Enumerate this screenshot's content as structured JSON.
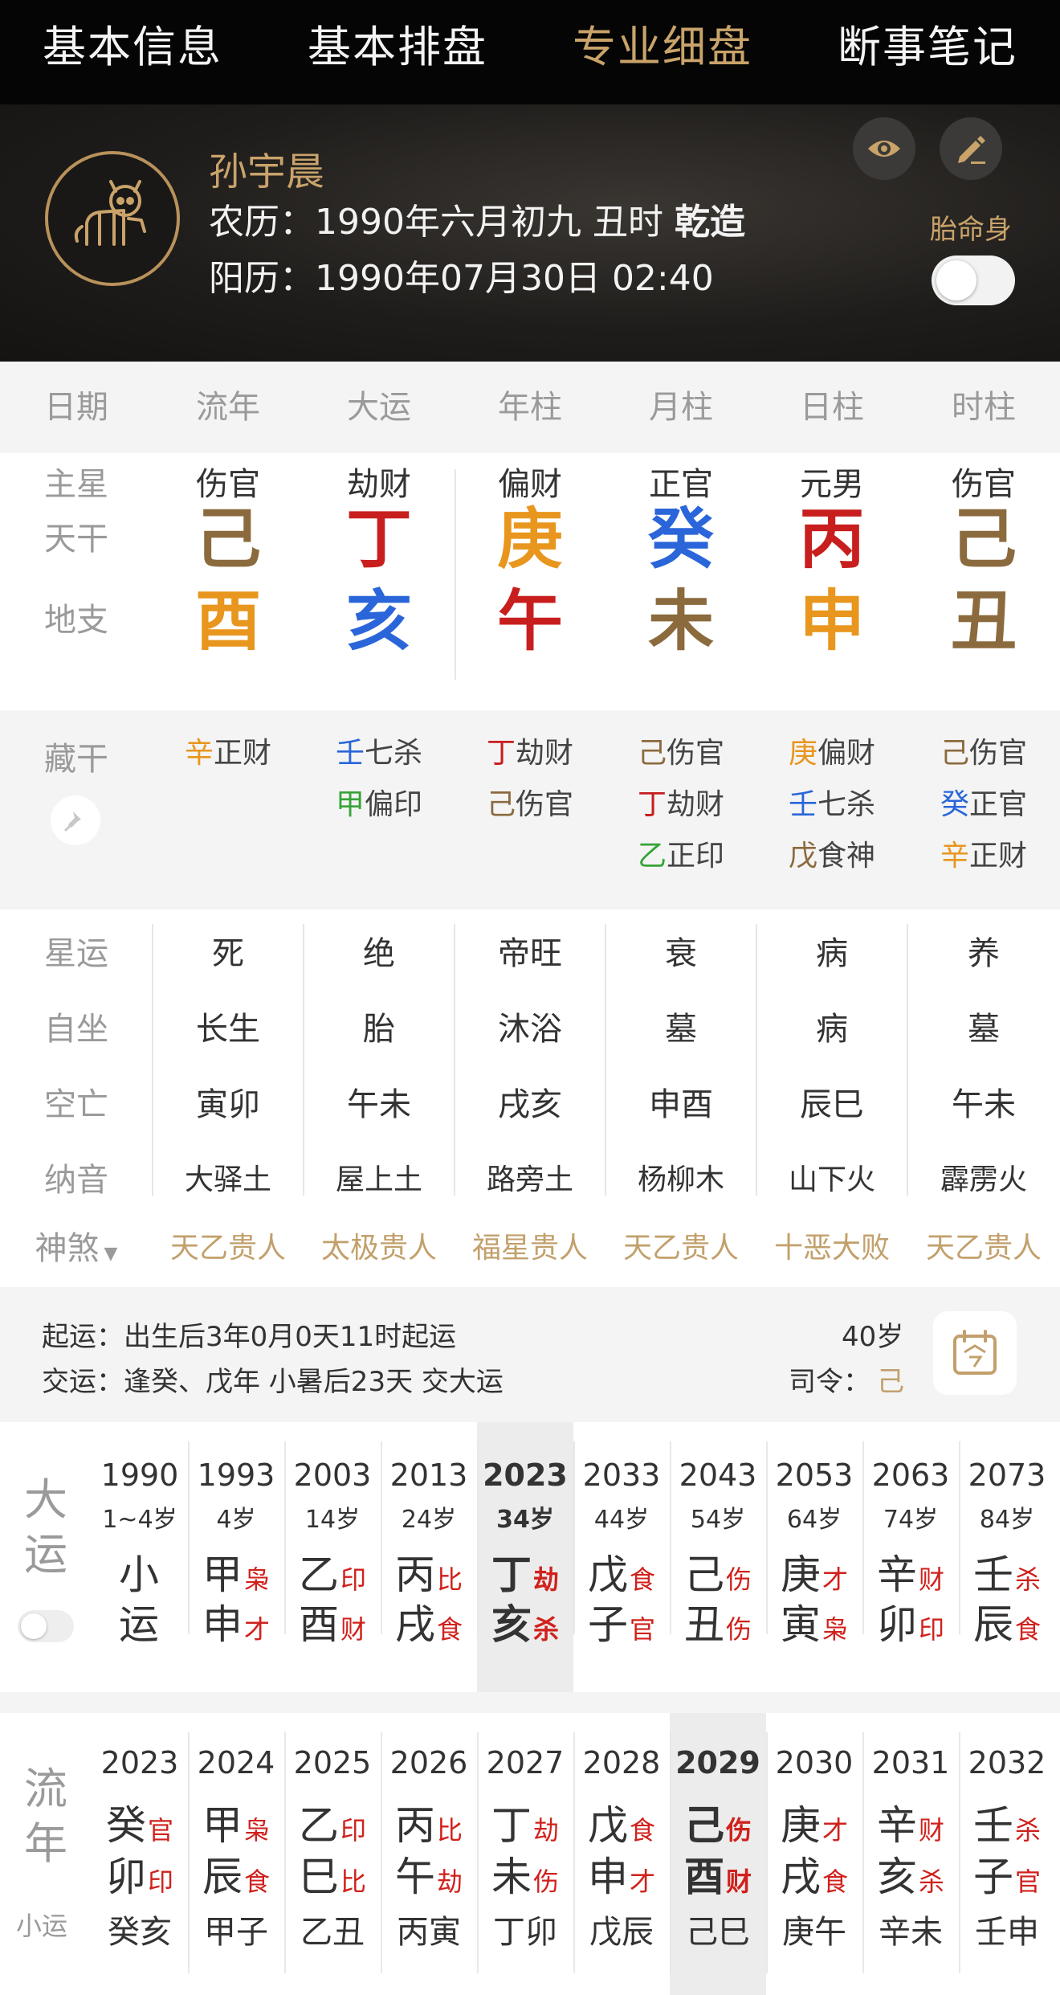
{
  "nav": [
    "基本信息",
    "基本排盘",
    "专业细盘",
    "断事笔记"
  ],
  "nav_active_index": 2,
  "colors": {
    "wood": "#36a336",
    "fire": "#c81e1e",
    "earth": "#8b6a3e",
    "metal": "#e8961e",
    "water": "#2a66d9",
    "accent": "#c9a36a",
    "ganzhi_red": "#d0211c"
  },
  "profile": {
    "name": "孙宇晨",
    "lunar_label": "农历：",
    "lunar": "1990年六月初九 丑时",
    "gender_tag": "乾造",
    "solar_label": "阳历：",
    "solar": "1990年07月30日 02:40",
    "taiming_label": "胎命身",
    "taiming_on": false,
    "avatar_icon": "horse-zodiac-icon"
  },
  "columns": [
    "日期",
    "流年",
    "大运",
    "年柱",
    "月柱",
    "日柱",
    "时柱"
  ],
  "row_labels": {
    "zhuxing": "主星",
    "tiangan": "天干",
    "dizhi": "地支",
    "canggan": "藏干",
    "xingyun": "星运",
    "zizuo": "自坐",
    "kongwang": "空亡",
    "nayin": "纳音",
    "shensha": "神煞"
  },
  "zhuxing": [
    "伤官",
    "劫财",
    "偏财",
    "正官",
    "元男",
    "伤官"
  ],
  "tiangan": [
    {
      "c": "己",
      "color": "#8b6a3e"
    },
    {
      "c": "丁",
      "color": "#c81e1e"
    },
    {
      "c": "庚",
      "color": "#e8961e"
    },
    {
      "c": "癸",
      "color": "#2a66d9"
    },
    {
      "c": "丙",
      "color": "#c81e1e"
    },
    {
      "c": "己",
      "color": "#8b6a3e"
    }
  ],
  "dizhi": [
    {
      "c": "酉",
      "color": "#e8961e"
    },
    {
      "c": "亥",
      "color": "#2a66d9"
    },
    {
      "c": "午",
      "color": "#c81e1e"
    },
    {
      "c": "未",
      "color": "#8b6a3e"
    },
    {
      "c": "申",
      "color": "#e8961e"
    },
    {
      "c": "丑",
      "color": "#8b6a3e"
    }
  ],
  "canggan": [
    [
      {
        "g": "辛",
        "color": "#e8961e",
        "s": "正财"
      }
    ],
    [
      {
        "g": "壬",
        "color": "#2a66d9",
        "s": "七杀"
      },
      {
        "g": "甲",
        "color": "#36a336",
        "s": "偏印"
      }
    ],
    [
      {
        "g": "丁",
        "color": "#c81e1e",
        "s": "劫财"
      },
      {
        "g": "己",
        "color": "#8b6a3e",
        "s": "伤官"
      }
    ],
    [
      {
        "g": "己",
        "color": "#8b6a3e",
        "s": "伤官"
      },
      {
        "g": "丁",
        "color": "#c81e1e",
        "s": "劫财"
      },
      {
        "g": "乙",
        "color": "#36a336",
        "s": "正印"
      }
    ],
    [
      {
        "g": "庚",
        "color": "#e8961e",
        "s": "偏财"
      },
      {
        "g": "壬",
        "color": "#2a66d9",
        "s": "七杀"
      },
      {
        "g": "戊",
        "color": "#8b6a3e",
        "s": "食神"
      }
    ],
    [
      {
        "g": "己",
        "color": "#8b6a3e",
        "s": "伤官"
      },
      {
        "g": "癸",
        "color": "#2a66d9",
        "s": "正官"
      },
      {
        "g": "辛",
        "color": "#e8961e",
        "s": "正财"
      }
    ]
  ],
  "xingyun": [
    "死",
    "绝",
    "帝旺",
    "衰",
    "病",
    "养"
  ],
  "zizuo": [
    "长生",
    "胎",
    "沐浴",
    "墓",
    "病",
    "墓"
  ],
  "kongwang": [
    "寅卯",
    "午未",
    "戌亥",
    "申酉",
    "辰巳",
    "午未"
  ],
  "nayin": [
    "大驿土",
    "屋上土",
    "路旁土",
    "杨柳木",
    "山下火",
    "霹雳火"
  ],
  "shensha": [
    "天乙贵人",
    "太极贵人",
    "福星贵人",
    "天乙贵人",
    "十恶大败",
    "天乙贵人"
  ],
  "qiyun": {
    "line1_label": "起运：",
    "line1": "出生后3年0月0天11时起运",
    "line2_label": "交运：",
    "line2": "逢癸、戊年 小暑后23天 交大运",
    "age": "40岁",
    "siling_label": "司令：",
    "siling": "己"
  },
  "dayun": {
    "label_top": "大",
    "label_bottom": "运",
    "toggle_on": false,
    "selected_index": 4,
    "items": [
      {
        "year": "1990",
        "age": "1~4岁",
        "g": "小",
        "gs": "",
        "z": "运",
        "zs": ""
      },
      {
        "year": "1993",
        "age": "4岁",
        "g": "甲",
        "gs": "枭",
        "z": "申",
        "zs": "才"
      },
      {
        "year": "2003",
        "age": "14岁",
        "g": "乙",
        "gs": "印",
        "z": "酉",
        "zs": "财"
      },
      {
        "year": "2013",
        "age": "24岁",
        "g": "丙",
        "gs": "比",
        "z": "戌",
        "zs": "食"
      },
      {
        "year": "2023",
        "age": "34岁",
        "g": "丁",
        "gs": "劫",
        "z": "亥",
        "zs": "杀"
      },
      {
        "year": "2033",
        "age": "44岁",
        "g": "戊",
        "gs": "食",
        "z": "子",
        "zs": "官"
      },
      {
        "year": "2043",
        "age": "54岁",
        "g": "己",
        "gs": "伤",
        "z": "丑",
        "zs": "伤"
      },
      {
        "year": "2053",
        "age": "64岁",
        "g": "庚",
        "gs": "才",
        "z": "寅",
        "zs": "枭"
      },
      {
        "year": "2063",
        "age": "74岁",
        "g": "辛",
        "gs": "财",
        "z": "卯",
        "zs": "印"
      },
      {
        "year": "2073",
        "age": "84岁",
        "g": "壬",
        "gs": "杀",
        "z": "辰",
        "zs": "食"
      }
    ]
  },
  "liunian": {
    "label_top": "流",
    "label_bottom": "年",
    "xiaoyun_label": "小运",
    "selected_index": 6,
    "items": [
      {
        "year": "2023",
        "g": "癸",
        "gs": "官",
        "z": "卯",
        "zs": "印",
        "xy": "癸亥"
      },
      {
        "year": "2024",
        "g": "甲",
        "gs": "枭",
        "z": "辰",
        "zs": "食",
        "xy": "甲子"
      },
      {
        "year": "2025",
        "g": "乙",
        "gs": "印",
        "z": "巳",
        "zs": "比",
        "xy": "乙丑"
      },
      {
        "year": "2026",
        "g": "丙",
        "gs": "比",
        "z": "午",
        "zs": "劫",
        "xy": "丙寅"
      },
      {
        "year": "2027",
        "g": "丁",
        "gs": "劫",
        "z": "未",
        "zs": "伤",
        "xy": "丁卯"
      },
      {
        "year": "2028",
        "g": "戊",
        "gs": "食",
        "z": "申",
        "zs": "才",
        "xy": "戊辰"
      },
      {
        "year": "2029",
        "g": "己",
        "gs": "伤",
        "z": "酉",
        "zs": "财",
        "xy": "己巳"
      },
      {
        "year": "2030",
        "g": "庚",
        "gs": "才",
        "z": "戌",
        "zs": "食",
        "xy": "庚午"
      },
      {
        "year": "2031",
        "g": "辛",
        "gs": "财",
        "z": "亥",
        "zs": "杀",
        "xy": "辛未"
      },
      {
        "year": "2032",
        "g": "壬",
        "gs": "杀",
        "z": "子",
        "zs": "官",
        "xy": "壬申"
      }
    ]
  }
}
